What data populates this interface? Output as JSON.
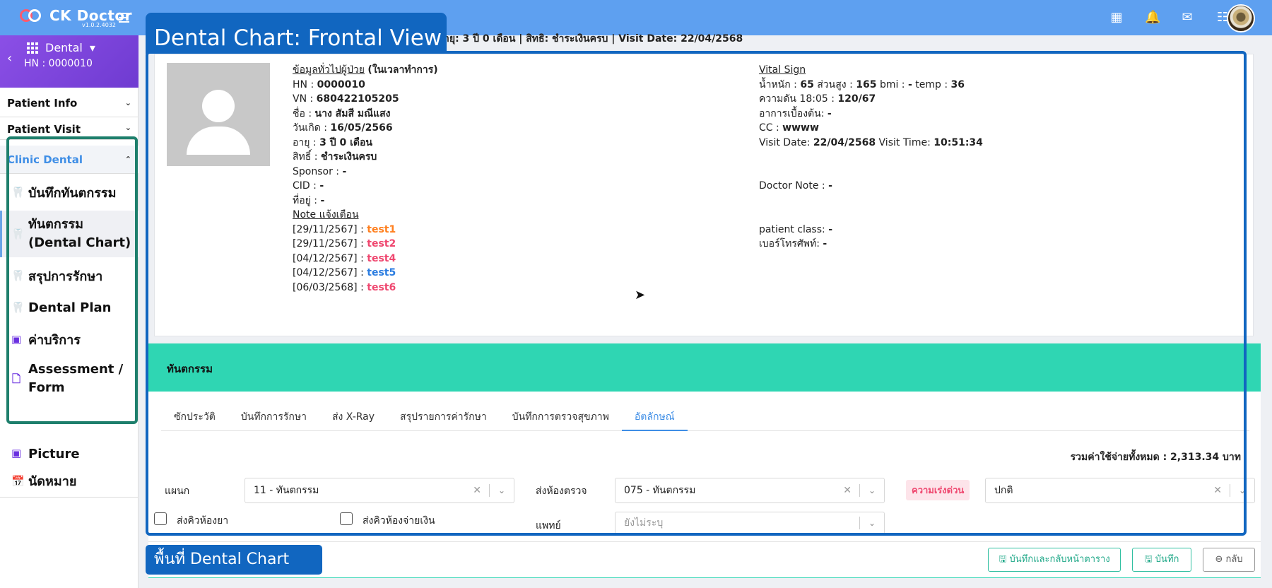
{
  "app": {
    "name": "CK Doctor",
    "version": "v1.0.2.4032"
  },
  "topbar": {
    "icons": [
      "apps-grid-icon",
      "bell-icon",
      "mail-icon",
      "checklist-icon"
    ],
    "icon_glyphs": [
      "▦",
      "🔔",
      "✉",
      "☷"
    ]
  },
  "sidebar": {
    "back_icon": "‹",
    "department": "Dental",
    "hn": "HN : 0000010",
    "sections": [
      {
        "label": "Patient Info",
        "chevron": "⌄"
      },
      {
        "label": "Patient Visit",
        "chevron": "⌄"
      },
      {
        "label": "Clinic Dental",
        "chevron": "⌃"
      }
    ],
    "items": [
      {
        "label": "บันทึกทันตกรรม",
        "icon": "tooth-icon",
        "glyph": "🦷"
      },
      {
        "label": "ทันตกรรม (Dental Chart)",
        "icon": "tooth-icon",
        "glyph": "🦷"
      },
      {
        "label": "สรุปการรักษา",
        "icon": "tooth-icon",
        "glyph": "🦷"
      },
      {
        "label": "Dental Plan",
        "icon": "tooth-icon",
        "glyph": "🦷"
      },
      {
        "label": "ค่าบริการ",
        "icon": "money-icon",
        "glyph": "▣"
      },
      {
        "label": "Assessment / Form",
        "icon": "document-icon",
        "glyph": "🗋"
      },
      {
        "label": "Picture",
        "icon": "image-icon",
        "glyph": "▣"
      },
      {
        "label": "นัดหมาย",
        "icon": "calendar-icon",
        "glyph": "📅"
      }
    ]
  },
  "patient_bar": "ายุ: 3 ปี 0 เดือน | สิทธิ: ชำระเงินครบ | Visit Date: 22/04/2568",
  "patient": {
    "heading": "ข้อมูลทั่วไปผู้ป่วย",
    "heading_suffix": "(ในเวลาทำการ)",
    "hn_label": "HN :",
    "hn": "0000010",
    "vn_label": "VN :",
    "vn": "680422105205",
    "name_label": "ชื่อ :",
    "name": "นาง สัมสี มณีแสง",
    "dob_label": "วันเกิด :",
    "dob": "16/05/2566",
    "age_label": "อายุ :",
    "age": "3 ปี 0 เดือน",
    "right_label": "สิทธิ์ :",
    "right": "ชำระเงินครบ",
    "sponsor_label": "Sponsor :",
    "sponsor": "-",
    "cid_label": "CID :",
    "cid": "-",
    "address_label": "ที่อยู่ :",
    "address": "-",
    "note_heading": "Note แจ้งเตือน",
    "notes": [
      {
        "date": "[29/11/2567] :",
        "text": "test1"
      },
      {
        "date": "[29/11/2567] :",
        "text": "test2"
      },
      {
        "date": "[04/12/2567] :",
        "text": "test4"
      },
      {
        "date": "[04/12/2567] :",
        "text": "test5"
      },
      {
        "date": "[06/03/2568] :",
        "text": "test6"
      }
    ]
  },
  "vital": {
    "heading": "Vital Sign",
    "weight_label": "น้ำหนัก :",
    "weight": "65",
    "height_label": "ส่วนสูง :",
    "height": "165",
    "bmi_label": "bmi :",
    "bmi": "-",
    "temp_label": "temp :",
    "temp": "36",
    "bp_label": "ความดัน 18:05 :",
    "bp": "120/67",
    "symptom_label": "อาการเบื้องต้น:",
    "symptom": "-",
    "cc_label": "CC :",
    "cc": "wwww",
    "visit_date_label": "Visit Date:",
    "visit_date": "22/04/2568",
    "visit_time_label": "Visit Time:",
    "visit_time": "10:51:34",
    "doctor_note_label": "Doctor Note :",
    "doctor_note": "-",
    "patient_class_label": "patient class:",
    "patient_class": "-",
    "phone_label": "เบอร์โทรศัพท์:",
    "phone": "-"
  },
  "dental_section": {
    "title": "ทันตกรรม",
    "tabs": [
      "ซักประวัติ",
      "บันทึกการรักษา",
      "ส่ง X-Ray",
      "สรุปรายการค่ารักษา",
      "บันทึกการตรวจสุขภาพ",
      "อัตลักษณ์"
    ],
    "active_tab": 5,
    "total": "รวมค่าใช้จ่ายทั้งหมด : 2,313.34 บาท",
    "dept_label": "แผนก",
    "dept_value": "11 - ทันตกรรม",
    "room_label": "ส่งห้องตรวจ",
    "room_value": "075 - ทันตกรรม",
    "urgency_label": "ความเร่งด่วน",
    "urgency_value": "ปกติ",
    "doctor_label": "แพทย์",
    "doctor_placeholder": "ยังไม่ระบุ",
    "queue_pharmacy": "ส่งคิวห้องยา",
    "queue_cashier": "ส่งคิวห้องจ่ายเงิน",
    "clear_glyph": "✕",
    "dropdown_glyph": "⌄"
  },
  "buttons": {
    "save_back": "🖫 บันทึกและกลับหน้าตาราง",
    "save": "🖫 บันทึก",
    "back": "⊖ กลับ"
  },
  "annotations": {
    "top": "Dental Chart: Frontal View",
    "bottom": "พื้นที่ Dental Chart"
  }
}
